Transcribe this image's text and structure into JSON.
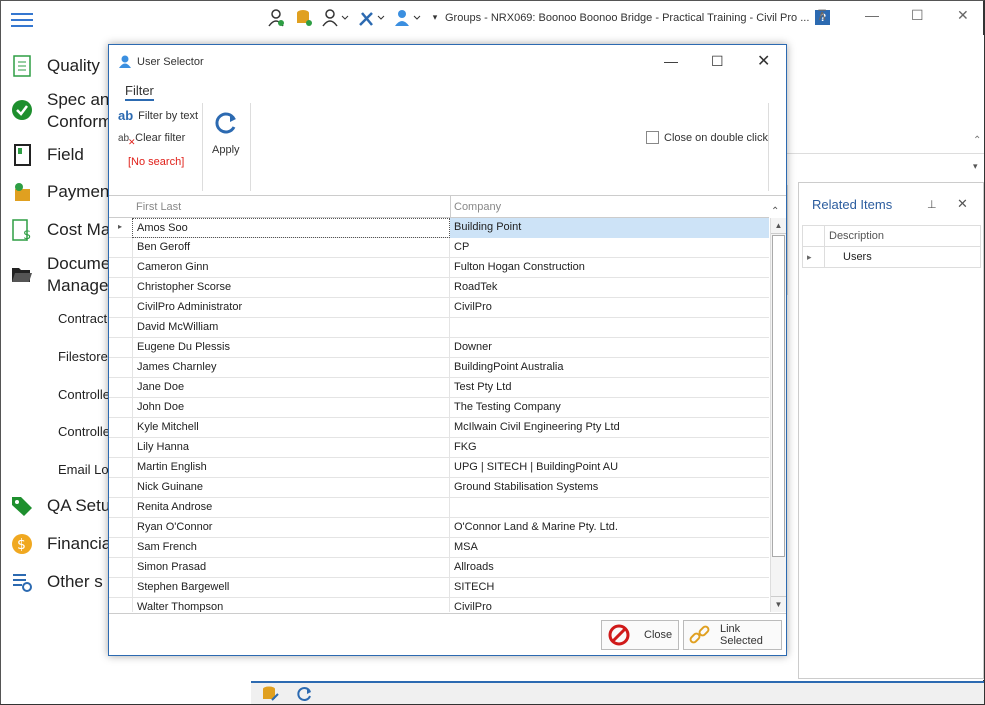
{
  "app": {
    "title": "Groups - NRX069: Boonoo Boonoo Bridge - Practical Training - Civil Pro ...",
    "help_label": "?"
  },
  "nav": {
    "items": [
      {
        "label": "Quality",
        "icon": "checklist-icon",
        "color": "#2e9e44"
      },
      {
        "label": "Spec and",
        "label2": "Conform",
        "icon": "check-circle-icon",
        "color": "#1e8f2e"
      },
      {
        "label": "Field",
        "icon": "field-book-icon",
        "color": "#222222"
      },
      {
        "label": "Paymen",
        "icon": "payment-icon",
        "color": "#e0a020"
      },
      {
        "label": "Cost Ma",
        "icon": "cost-sheet-icon",
        "color": "#2e9e44"
      },
      {
        "label": "Docume",
        "label2": "Manage",
        "icon": "folder-open-icon",
        "color": "#222222"
      },
      {
        "label": "QA Setu",
        "icon": "tag-icon",
        "color": "#1e8f2e"
      },
      {
        "label": "Financia",
        "icon": "dollar-icon",
        "color": "#f0a820"
      },
      {
        "label": "Other s",
        "icon": "settings-list-icon",
        "color": "#2c6ab1"
      }
    ],
    "subitems": [
      "Contract",
      "Filestore",
      "Controlle",
      "Controlle",
      "Email Lo"
    ]
  },
  "related": {
    "title": "Related Items",
    "column": "Description",
    "row": "Users"
  },
  "dialog": {
    "title": "User Selector",
    "tab": "Filter",
    "filter_by_text": "Filter by text",
    "clear_filter": "Clear filter",
    "no_search": "[No search]",
    "apply": "Apply",
    "close_on_double_click": "Close on double click",
    "columns": [
      "First Last",
      "Company"
    ],
    "rows": [
      {
        "name": "Amos Soo",
        "company": "Building Point"
      },
      {
        "name": "Ben  Geroff",
        "company": "CP"
      },
      {
        "name": "Cameron Ginn",
        "company": "Fulton Hogan Construction"
      },
      {
        "name": "Christopher Scorse",
        "company": "RoadTek"
      },
      {
        "name": "CivilPro Administrator",
        "company": "CivilPro"
      },
      {
        "name": "David McWilliam",
        "company": ""
      },
      {
        "name": "Eugene Du Plessis",
        "company": "Downer"
      },
      {
        "name": "James Charnley",
        "company": "BuildingPoint Australia"
      },
      {
        "name": "Jane Doe",
        "company": "Test Pty Ltd"
      },
      {
        "name": "John  Doe",
        "company": "The Testing Company"
      },
      {
        "name": "Kyle Mitchell",
        "company": "McIlwain Civil Engineering Pty Ltd"
      },
      {
        "name": "Lily Hanna",
        "company": "FKG"
      },
      {
        "name": "Martin English",
        "company": "UPG | SITECH | BuildingPoint AU"
      },
      {
        "name": "Nick Guinane",
        "company": "Ground Stabilisation Systems"
      },
      {
        "name": "Renita Androse",
        "company": ""
      },
      {
        "name": "Ryan O'Connor",
        "company": "O'Connor Land & Marine Pty. Ltd."
      },
      {
        "name": "Sam French",
        "company": "MSA"
      },
      {
        "name": "Simon Prasad",
        "company": "Allroads"
      },
      {
        "name": "Stephen Bargewell",
        "company": "SITECH"
      },
      {
        "name": "Walter  Thompson",
        "company": "CivilPro"
      }
    ],
    "close_button": "Close",
    "link_button": "Link Selected"
  },
  "colors": {
    "accent": "#2c6ab1",
    "selected_row": "#cde3f7",
    "no_search": "#e0201a"
  }
}
